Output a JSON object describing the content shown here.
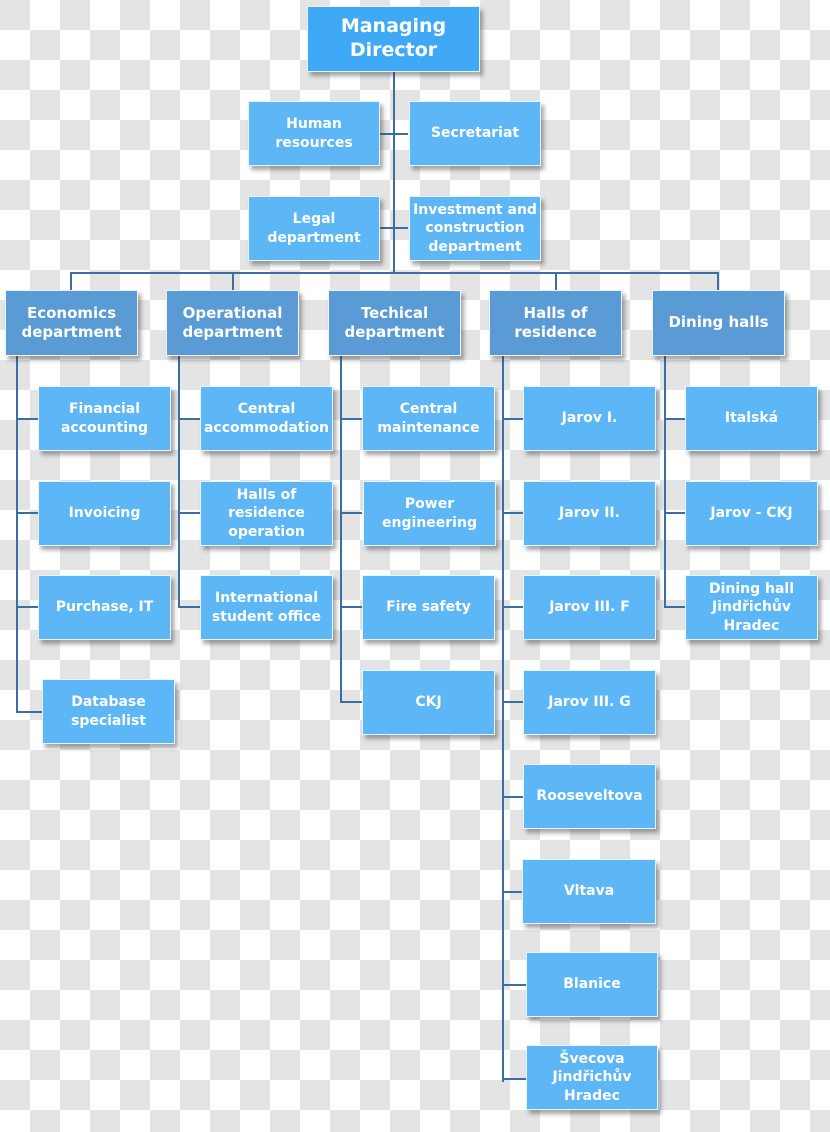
{
  "colors": {
    "top_box": "#3fa9f5",
    "department_box": "#5b9bd5",
    "unit_box": "#5db6f6",
    "connector": "#3a6ea5",
    "text": "#ffffff"
  },
  "root": {
    "label": "Managing Director"
  },
  "staff": [
    {
      "label": "Human resources"
    },
    {
      "label": "Secretariat"
    },
    {
      "label": "Legal department"
    },
    {
      "label": "Investment and construction department"
    }
  ],
  "departments": [
    {
      "label": "Economics department",
      "units": [
        {
          "label": "Financial accounting"
        },
        {
          "label": "Invoicing"
        },
        {
          "label": "Purchase, IT"
        },
        {
          "label": "Database specialist"
        }
      ]
    },
    {
      "label": "Operational department",
      "units": [
        {
          "label": "Central accommodation"
        },
        {
          "label": "Halls of residence operation"
        },
        {
          "label": "International student office"
        }
      ]
    },
    {
      "label": "Techical department",
      "units": [
        {
          "label": "Central maintenance"
        },
        {
          "label": "Power engineering"
        },
        {
          "label": "Fire safety"
        },
        {
          "label": "CKJ"
        }
      ]
    },
    {
      "label": "Halls of residence",
      "units": [
        {
          "label": "Jarov I."
        },
        {
          "label": "Jarov II."
        },
        {
          "label": "Jarov III. F"
        },
        {
          "label": "Jarov III. G"
        },
        {
          "label": "Rooseveltova"
        },
        {
          "label": "Vltava"
        },
        {
          "label": "Blanice"
        },
        {
          "label": "Švecova Jindřichův Hradec"
        }
      ]
    },
    {
      "label": "Dining halls",
      "units": [
        {
          "label": "Italská"
        },
        {
          "label": "Jarov - CKJ"
        },
        {
          "label": "Dining hall Jindřichův Hradec"
        }
      ]
    }
  ]
}
